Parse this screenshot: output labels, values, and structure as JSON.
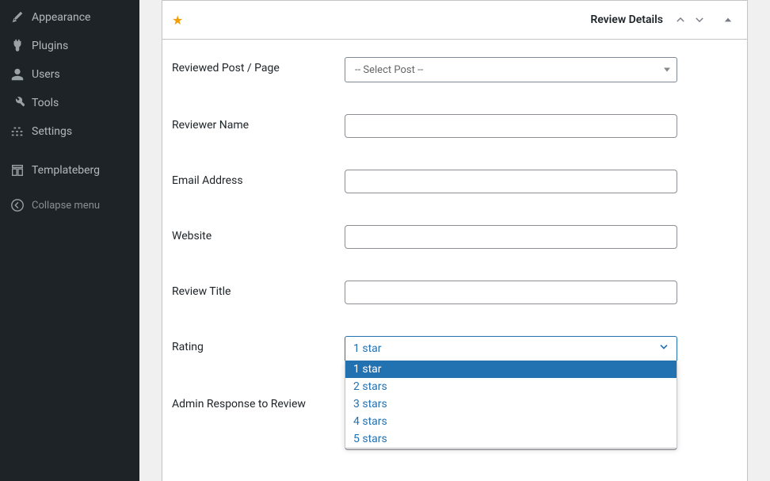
{
  "sidebar": {
    "items": [
      {
        "label": "Appearance",
        "icon": "appearance"
      },
      {
        "label": "Plugins",
        "icon": "plugins"
      },
      {
        "label": "Users",
        "icon": "users"
      },
      {
        "label": "Tools",
        "icon": "tools"
      },
      {
        "label": "Settings",
        "icon": "settings"
      }
    ],
    "templateberg": "Templateberg",
    "collapse": "Collapse menu"
  },
  "panel": {
    "title": "Review Details"
  },
  "fields": {
    "reviewed_post": {
      "label": "Reviewed Post / Page",
      "placeholder": "-- Select Post --"
    },
    "reviewer_name": {
      "label": "Reviewer Name",
      "value": ""
    },
    "email": {
      "label": "Email Address",
      "value": ""
    },
    "website": {
      "label": "Website",
      "value": ""
    },
    "review_title": {
      "label": "Review Title",
      "value": ""
    },
    "rating": {
      "label": "Rating",
      "selected": "1 star",
      "options": [
        "1 star",
        "2 stars",
        "3 stars",
        "4 stars",
        "5 stars"
      ]
    },
    "admin_response": {
      "label": "Admin Response to Review",
      "value": ""
    }
  }
}
